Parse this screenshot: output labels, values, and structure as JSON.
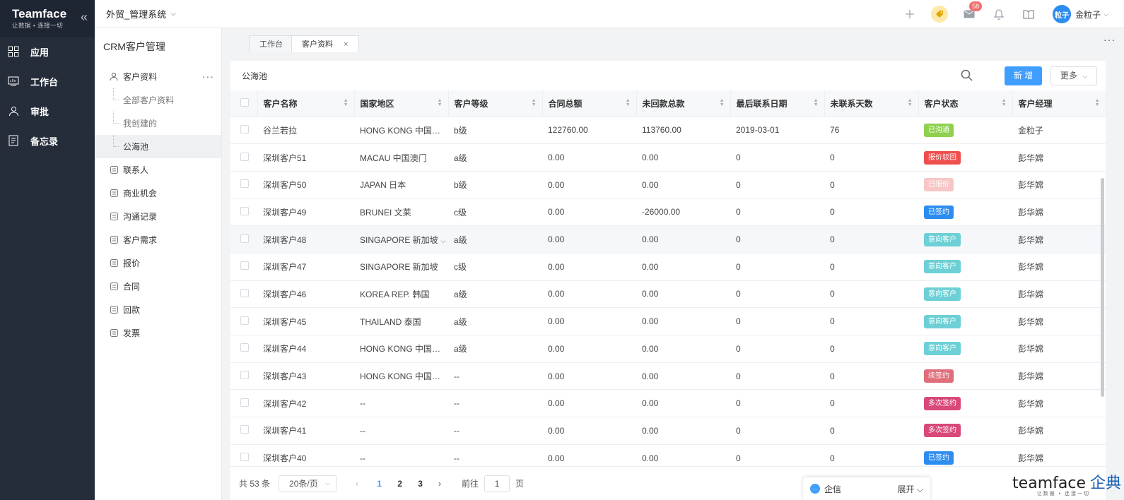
{
  "rail": {
    "brand": "Teamface",
    "slogan": "让数据 • 连接一切",
    "items": [
      {
        "label": "应用",
        "icon": "apps-icon"
      },
      {
        "label": "工作台",
        "icon": "dashboard-icon"
      },
      {
        "label": "审批",
        "icon": "approval-user-icon"
      },
      {
        "label": "备忘录",
        "icon": "memo-icon"
      }
    ]
  },
  "topbar": {
    "system_title": "外贸_管理系统",
    "mail_badge": "58",
    "avatar_text": "粒子",
    "username": "金粒子"
  },
  "sidebar": {
    "module_title": "CRM客户管理",
    "groups": [
      {
        "label": "客户资料",
        "icon": "customer-icon"
      },
      {
        "label": "联系人",
        "icon": "contact-icon"
      },
      {
        "label": "商业机会",
        "icon": "opportunity-icon"
      },
      {
        "label": "沟通记录",
        "icon": "communication-icon"
      },
      {
        "label": "客户需求",
        "icon": "demand-icon"
      },
      {
        "label": "报价",
        "icon": "cart-icon"
      },
      {
        "label": "合同",
        "icon": "contract-icon"
      },
      {
        "label": "回款",
        "icon": "payment-icon"
      },
      {
        "label": "发票",
        "icon": "invoice-icon"
      }
    ],
    "sub_items": [
      "全部客户资料",
      "我创建的",
      "公海池"
    ]
  },
  "tabs": [
    {
      "label": "工作台"
    },
    {
      "label": "客户资料",
      "close": "×"
    }
  ],
  "main": {
    "title": "公海池",
    "new_button": "新 增",
    "more_button": "更多"
  },
  "table": {
    "columns": [
      "客户名称",
      "国家地区",
      "客户等级",
      "合同总额",
      "未回款总款",
      "最后联系日期",
      "未联系天数",
      "客户状态",
      "客户经理"
    ],
    "rows": [
      {
        "name": "谷兰若拉",
        "region": "HONG KONG 中国香港",
        "level": "b级",
        "contract": "122760.00",
        "unpaid": "113760.00",
        "last": "2019-03-01",
        "days": "76",
        "status": "已沟通",
        "status_color": "#8fd14f",
        "manager": "金粒子"
      },
      {
        "name": "深圳客户51",
        "region": "MACAU 中国澳门",
        "level": "a级",
        "contract": "0.00",
        "unpaid": "0.00",
        "last": "0",
        "days": "0",
        "status": "报价驳回",
        "status_color": "#f04d4d",
        "manager": "彭华嫦"
      },
      {
        "name": "深圳客户50",
        "region": "JAPAN 日本",
        "level": "b级",
        "contract": "0.00",
        "unpaid": "0.00",
        "last": "0",
        "days": "0",
        "status": "已报价",
        "status_color": "#f7c6c6",
        "manager": "彭华嫦"
      },
      {
        "name": "深圳客户49",
        "region": "BRUNEI 文莱",
        "level": "c级",
        "contract": "0.00",
        "unpaid": "-26000.00",
        "last": "0",
        "days": "0",
        "status": "已签约",
        "status_color": "#2d8cf0",
        "manager": "彭华嫦"
      },
      {
        "name": "深圳客户48",
        "region": "SINGAPORE 新加坡",
        "level": "a级",
        "contract": "0.00",
        "unpaid": "0.00",
        "last": "0",
        "days": "0",
        "status": "意向客户",
        "status_color": "#6cd0d6",
        "manager": "彭华嫦"
      },
      {
        "name": "深圳客户47",
        "region": "SINGAPORE 新加坡",
        "level": "c级",
        "contract": "0.00",
        "unpaid": "0.00",
        "last": "0",
        "days": "0",
        "status": "意向客户",
        "status_color": "#6cd0d6",
        "manager": "彭华嫦"
      },
      {
        "name": "深圳客户46",
        "region": "KOREA REP. 韩国",
        "level": "a级",
        "contract": "0.00",
        "unpaid": "0.00",
        "last": "0",
        "days": "0",
        "status": "意向客户",
        "status_color": "#6cd0d6",
        "manager": "彭华嫦"
      },
      {
        "name": "深圳客户45",
        "region": "THAILAND 泰国",
        "level": "a级",
        "contract": "0.00",
        "unpaid": "0.00",
        "last": "0",
        "days": "0",
        "status": "意向客户",
        "status_color": "#6cd0d6",
        "manager": "彭华嫦"
      },
      {
        "name": "深圳客户44",
        "region": "HONG KONG 中国香港",
        "level": "a级",
        "contract": "0.00",
        "unpaid": "0.00",
        "last": "0",
        "days": "0",
        "status": "意向客户",
        "status_color": "#6cd0d6",
        "manager": "彭华嫦"
      },
      {
        "name": "深圳客户43",
        "region": "HONG KONG 中国香港",
        "level": "--",
        "contract": "0.00",
        "unpaid": "0.00",
        "last": "0",
        "days": "0",
        "status": "续签约",
        "status_color": "#e06e7a",
        "manager": "彭华嫦"
      },
      {
        "name": "深圳客户42",
        "region": "--",
        "level": "--",
        "contract": "0.00",
        "unpaid": "0.00",
        "last": "0",
        "days": "0",
        "status": "多次签约",
        "status_color": "#d9487a",
        "manager": "彭华嫦"
      },
      {
        "name": "深圳客户41",
        "region": "--",
        "level": "--",
        "contract": "0.00",
        "unpaid": "0.00",
        "last": "0",
        "days": "0",
        "status": "多次签约",
        "status_color": "#d9487a",
        "manager": "彭华嫦"
      },
      {
        "name": "深圳客户40",
        "region": "--",
        "level": "--",
        "contract": "0.00",
        "unpaid": "0.00",
        "last": "0",
        "days": "0",
        "status": "已签约",
        "status_color": "#2d8cf0",
        "manager": "彭华嫦"
      }
    ]
  },
  "pager": {
    "total": "共 53 条",
    "page_size": "20条/页",
    "pages": [
      "1",
      "2",
      "3"
    ],
    "goto_label": "前往",
    "goto_value": "1",
    "unit": "页"
  },
  "chat": {
    "label": "企信",
    "expand": "展开"
  },
  "watermark": {
    "brand": "teamface",
    "cn": "企典",
    "slogan": "让数据 • 连接一切"
  }
}
